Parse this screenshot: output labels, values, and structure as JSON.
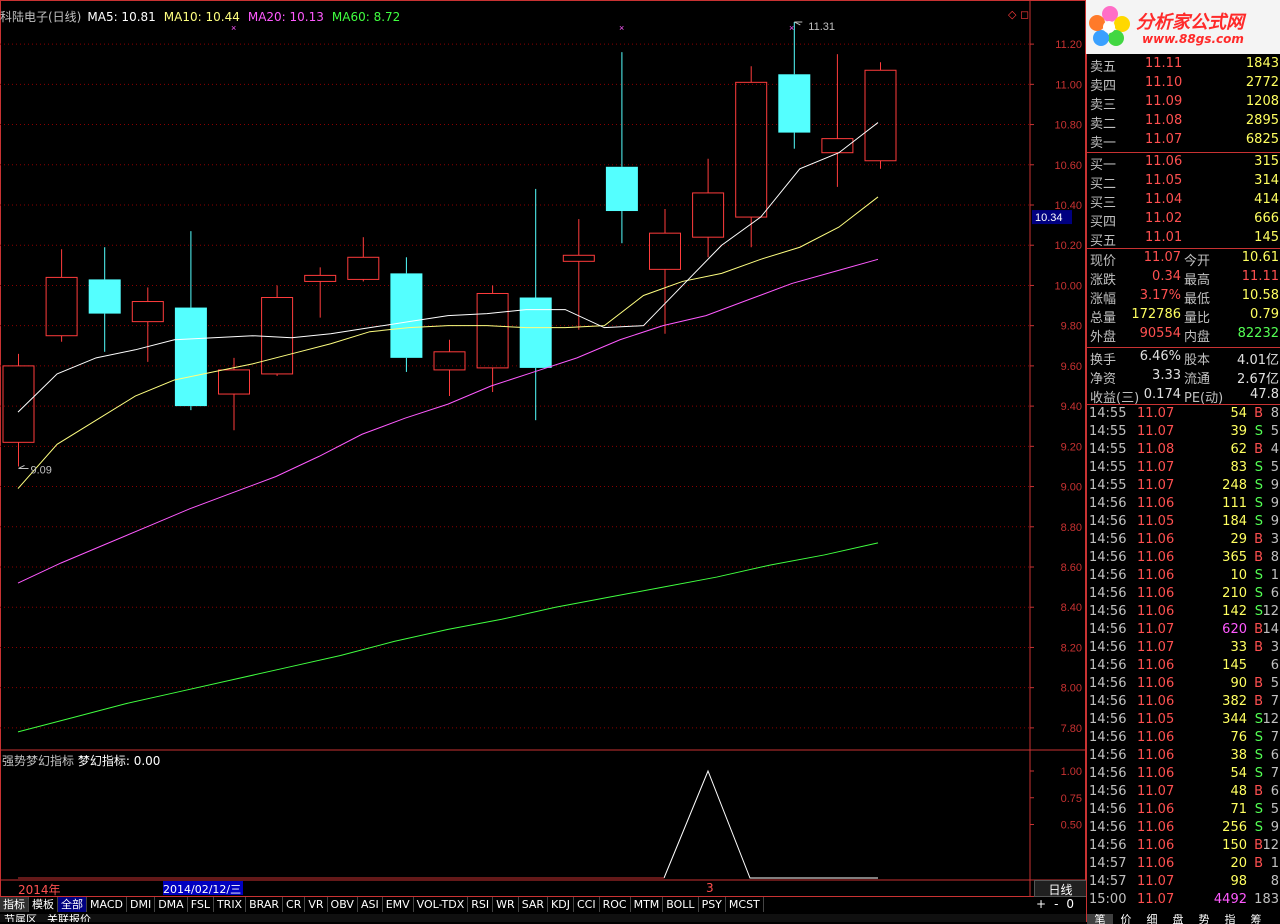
{
  "header": {
    "title": "科陆电子(日线)",
    "ma5": "MA5: 10.81",
    "ma10": "MA10: 10.44",
    "ma20": "MA20: 10.13",
    "ma60": "MA60: 8.72",
    "corner_icons": "◇ ◻"
  },
  "price_axis": [
    "11.20",
    "11.00",
    "10.80",
    "10.60",
    "10.40",
    "10.20",
    "10.00",
    "9.80",
    "9.60",
    "9.40",
    "9.20",
    "9.00",
    "8.80",
    "8.60",
    "8.40",
    "8.20",
    "8.00",
    "7.80"
  ],
  "current_price_marker": "10.34",
  "high_marker": "11.31",
  "low_marker": "9.09",
  "indicator": {
    "title": "强势梦幻指标",
    "value_label": "梦幻指标: 0.00",
    "axis": [
      "1.00",
      "0.75",
      "0.50"
    ]
  },
  "time_axis": {
    "year": "2014年",
    "date": "2014/02/12/三",
    "marker": "3",
    "period": "日线"
  },
  "tabs": [
    "指标",
    "模板",
    "全部",
    "MACD",
    "DMI",
    "DMA",
    "FSL",
    "TRIX",
    "BRAR",
    "CR",
    "VR",
    "OBV",
    "ASI",
    "EMV",
    "VOL-TDX",
    "RSI",
    "WR",
    "SAR",
    "KDJ",
    "CCI",
    "ROC",
    "MTM",
    "BOLL",
    "PSY",
    "MCST"
  ],
  "zoom": [
    "+",
    "-",
    "0"
  ],
  "bottom_tabs": [
    "节属区",
    "关联报价"
  ],
  "logo": {
    "text": "分析家公式网",
    "url": "www.88gs.com"
  },
  "order_book": {
    "asks": [
      {
        "label": "卖五",
        "price": "11.11",
        "vol": "1843"
      },
      {
        "label": "卖四",
        "price": "11.10",
        "vol": "2772"
      },
      {
        "label": "卖三",
        "price": "11.09",
        "vol": "1208"
      },
      {
        "label": "卖二",
        "price": "11.08",
        "vol": "2895"
      },
      {
        "label": "卖一",
        "price": "11.07",
        "vol": "6825"
      }
    ],
    "bids": [
      {
        "label": "买一",
        "price": "11.06",
        "vol": "315"
      },
      {
        "label": "买二",
        "price": "11.05",
        "vol": "314"
      },
      {
        "label": "买三",
        "price": "11.04",
        "vol": "414"
      },
      {
        "label": "买四",
        "price": "11.02",
        "vol": "666"
      },
      {
        "label": "买五",
        "price": "11.01",
        "vol": "145"
      }
    ]
  },
  "stats": [
    {
      "l1": "现价",
      "v1": "11.07",
      "l2": "今开",
      "v2": "10.61",
      "c1": "#ff5050",
      "c2": "#ffff60"
    },
    {
      "l1": "涨跌",
      "v1": "0.34",
      "l2": "最高",
      "v2": "11.11",
      "c1": "#ff5050",
      "c2": "#ff5050"
    },
    {
      "l1": "涨幅",
      "v1": "3.17%",
      "l2": "最低",
      "v2": "10.58",
      "c1": "#ff5050",
      "c2": "#ffff60"
    },
    {
      "l1": "总量",
      "v1": "172786",
      "l2": "量比",
      "v2": "0.79",
      "c1": "#ffff60",
      "c2": "#ffff60"
    },
    {
      "l1": "外盘",
      "v1": "90554",
      "l2": "内盘",
      "v2": "82232",
      "c1": "#ff5050",
      "c2": "#54ff54"
    },
    {
      "l1": "换手",
      "v1": "6.46%",
      "l2": "股本",
      "v2": "4.01亿",
      "c1": "#e0e0e0",
      "c2": "#e0e0e0"
    },
    {
      "l1": "净资",
      "v1": "3.33",
      "l2": "流通",
      "v2": "2.67亿",
      "c1": "#e0e0e0",
      "c2": "#e0e0e0"
    },
    {
      "l1": "收益(三)",
      "v1": "0.174",
      "l2": "PE(动)",
      "v2": "47.8",
      "c1": "#e0e0e0",
      "c2": "#e0e0e0"
    }
  ],
  "ticks": [
    {
      "t": "14:55",
      "p": "11.07",
      "v": "54",
      "f": "B",
      "c": "8"
    },
    {
      "t": "14:55",
      "p": "11.07",
      "v": "39",
      "f": "S",
      "c": "5"
    },
    {
      "t": "14:55",
      "p": "11.08",
      "v": "62",
      "f": "B",
      "c": "4"
    },
    {
      "t": "14:55",
      "p": "11.07",
      "v": "83",
      "f": "S",
      "c": "5"
    },
    {
      "t": "14:55",
      "p": "11.07",
      "v": "248",
      "f": "S",
      "c": "9"
    },
    {
      "t": "14:56",
      "p": "11.06",
      "v": "111",
      "f": "S",
      "c": "9"
    },
    {
      "t": "14:56",
      "p": "11.05",
      "v": "184",
      "f": "S",
      "c": "9"
    },
    {
      "t": "14:56",
      "p": "11.06",
      "v": "29",
      "f": "B",
      "c": "3"
    },
    {
      "t": "14:56",
      "p": "11.06",
      "v": "365",
      "f": "B",
      "c": "8"
    },
    {
      "t": "14:56",
      "p": "11.06",
      "v": "10",
      "f": "S",
      "c": "1"
    },
    {
      "t": "14:56",
      "p": "11.06",
      "v": "210",
      "f": "S",
      "c": "6"
    },
    {
      "t": "14:56",
      "p": "11.06",
      "v": "142",
      "f": "S",
      "c": "12"
    },
    {
      "t": "14:56",
      "p": "11.07",
      "v": "620",
      "f": "B",
      "c": "14"
    },
    {
      "t": "14:56",
      "p": "11.07",
      "v": "33",
      "f": "B",
      "c": "3"
    },
    {
      "t": "14:56",
      "p": "11.06",
      "v": "145",
      "f": "",
      "c": "6"
    },
    {
      "t": "14:56",
      "p": "11.06",
      "v": "90",
      "f": "B",
      "c": "5"
    },
    {
      "t": "14:56",
      "p": "11.06",
      "v": "382",
      "f": "B",
      "c": "7"
    },
    {
      "t": "14:56",
      "p": "11.05",
      "v": "344",
      "f": "S",
      "c": "12"
    },
    {
      "t": "14:56",
      "p": "11.06",
      "v": "76",
      "f": "S",
      "c": "7"
    },
    {
      "t": "14:56",
      "p": "11.06",
      "v": "38",
      "f": "S",
      "c": "6"
    },
    {
      "t": "14:56",
      "p": "11.06",
      "v": "54",
      "f": "S",
      "c": "7"
    },
    {
      "t": "14:56",
      "p": "11.07",
      "v": "48",
      "f": "B",
      "c": "6"
    },
    {
      "t": "14:56",
      "p": "11.06",
      "v": "71",
      "f": "S",
      "c": "5"
    },
    {
      "t": "14:56",
      "p": "11.06",
      "v": "256",
      "f": "S",
      "c": "9"
    },
    {
      "t": "14:56",
      "p": "11.06",
      "v": "150",
      "f": "B",
      "c": "12"
    },
    {
      "t": "14:57",
      "p": "11.06",
      "v": "20",
      "f": "B",
      "c": "1"
    },
    {
      "t": "14:57",
      "p": "11.07",
      "v": "98",
      "f": "",
      "c": "8"
    },
    {
      "t": "15:00",
      "p": "11.07",
      "v": "4492",
      "f": "",
      "c": "183"
    }
  ],
  "right_bottom_tabs": [
    "笔",
    "价",
    "细",
    "盘",
    "势",
    "指",
    "筹"
  ],
  "colors": {
    "up": "#ff3c3c",
    "down": "#54ffff",
    "ma5": "#ffffff",
    "ma10": "#ffff80",
    "ma20": "#ff5aff",
    "ma60": "#40ff40",
    "grid": "#8a0000",
    "axis": "#c83232"
  },
  "chart_data": {
    "type": "candlestick",
    "y_range": [
      7.7,
      11.3
    ],
    "candles": [
      {
        "o": 9.6,
        "c": 9.22,
        "h": 9.66,
        "l": 9.1,
        "d": "down_red"
      },
      {
        "o": 9.75,
        "c": 10.04,
        "h": 10.18,
        "l": 9.72,
        "up": true
      },
      {
        "o": 10.03,
        "c": 9.86,
        "h": 10.19,
        "l": 9.67,
        "up": false
      },
      {
        "o": 9.82,
        "c": 9.92,
        "h": 9.99,
        "l": 9.62,
        "up": true
      },
      {
        "o": 9.89,
        "c": 9.4,
        "h": 10.27,
        "l": 9.38,
        "up": false
      },
      {
        "o": 9.46,
        "c": 9.58,
        "h": 9.64,
        "l": 9.28,
        "up": true
      },
      {
        "o": 9.56,
        "c": 9.94,
        "h": 10.0,
        "l": 9.55,
        "up": true
      },
      {
        "o": 10.02,
        "c": 10.05,
        "h": 10.09,
        "l": 9.84,
        "up": true
      },
      {
        "o": 10.03,
        "c": 10.14,
        "h": 10.24,
        "l": 10.02,
        "up": true
      },
      {
        "o": 10.06,
        "c": 9.64,
        "h": 10.14,
        "l": 9.57,
        "up": false
      },
      {
        "o": 9.58,
        "c": 9.67,
        "h": 9.73,
        "l": 9.45,
        "up": true
      },
      {
        "o": 9.59,
        "c": 9.96,
        "h": 10.0,
        "l": 9.47,
        "up": true
      },
      {
        "o": 9.94,
        "c": 9.59,
        "h": 10.48,
        "l": 9.33,
        "up": false
      },
      {
        "o": 10.12,
        "c": 10.15,
        "h": 10.33,
        "l": 9.78,
        "up": true
      },
      {
        "o": 10.59,
        "c": 10.37,
        "h": 11.16,
        "l": 10.21,
        "up": false
      },
      {
        "o": 10.08,
        "c": 10.26,
        "h": 10.38,
        "l": 9.76,
        "up": true
      },
      {
        "o": 10.24,
        "c": 10.46,
        "h": 10.63,
        "l": 10.14,
        "up": true
      },
      {
        "o": 10.34,
        "c": 11.01,
        "h": 11.09,
        "l": 10.19,
        "up": true
      },
      {
        "o": 11.05,
        "c": 10.76,
        "h": 11.31,
        "l": 10.68,
        "up": false
      },
      {
        "o": 10.66,
        "c": 10.73,
        "h": 11.15,
        "l": 10.49,
        "up": true
      },
      {
        "o": 10.62,
        "c": 11.07,
        "h": 11.11,
        "l": 10.58,
        "up": true
      }
    ],
    "ma5": [
      9.37,
      9.56,
      9.64,
      9.68,
      9.73,
      9.74,
      9.75,
      9.74,
      9.76,
      9.79,
      9.82,
      9.85,
      9.86,
      9.88,
      9.88,
      9.79,
      9.8,
      10.0,
      10.2,
      10.34,
      10.58,
      10.66,
      10.81
    ],
    "ma10": [
      8.99,
      9.21,
      9.33,
      9.45,
      9.53,
      9.57,
      9.61,
      9.66,
      9.71,
      9.77,
      9.79,
      9.8,
      9.8,
      9.79,
      9.79,
      9.8,
      9.95,
      10.02,
      10.06,
      10.13,
      10.19,
      10.29,
      10.44
    ],
    "ma20": [
      8.52,
      8.62,
      8.71,
      8.8,
      8.89,
      8.97,
      9.05,
      9.15,
      9.26,
      9.34,
      9.41,
      9.5,
      9.57,
      9.64,
      9.73,
      9.8,
      9.85,
      9.93,
      10.01,
      10.07,
      10.13
    ],
    "ma60": [
      7.78,
      7.85,
      7.92,
      7.98,
      8.04,
      8.1,
      8.16,
      8.23,
      8.29,
      8.34,
      8.4,
      8.45,
      8.5,
      8.55,
      8.61,
      8.66,
      8.72
    ],
    "indicator": [
      0,
      0,
      0,
      0,
      0,
      0,
      0,
      0,
      0,
      0,
      0,
      0,
      0,
      0,
      0,
      0,
      0,
      0,
      1,
      0,
      0,
      0
    ]
  }
}
